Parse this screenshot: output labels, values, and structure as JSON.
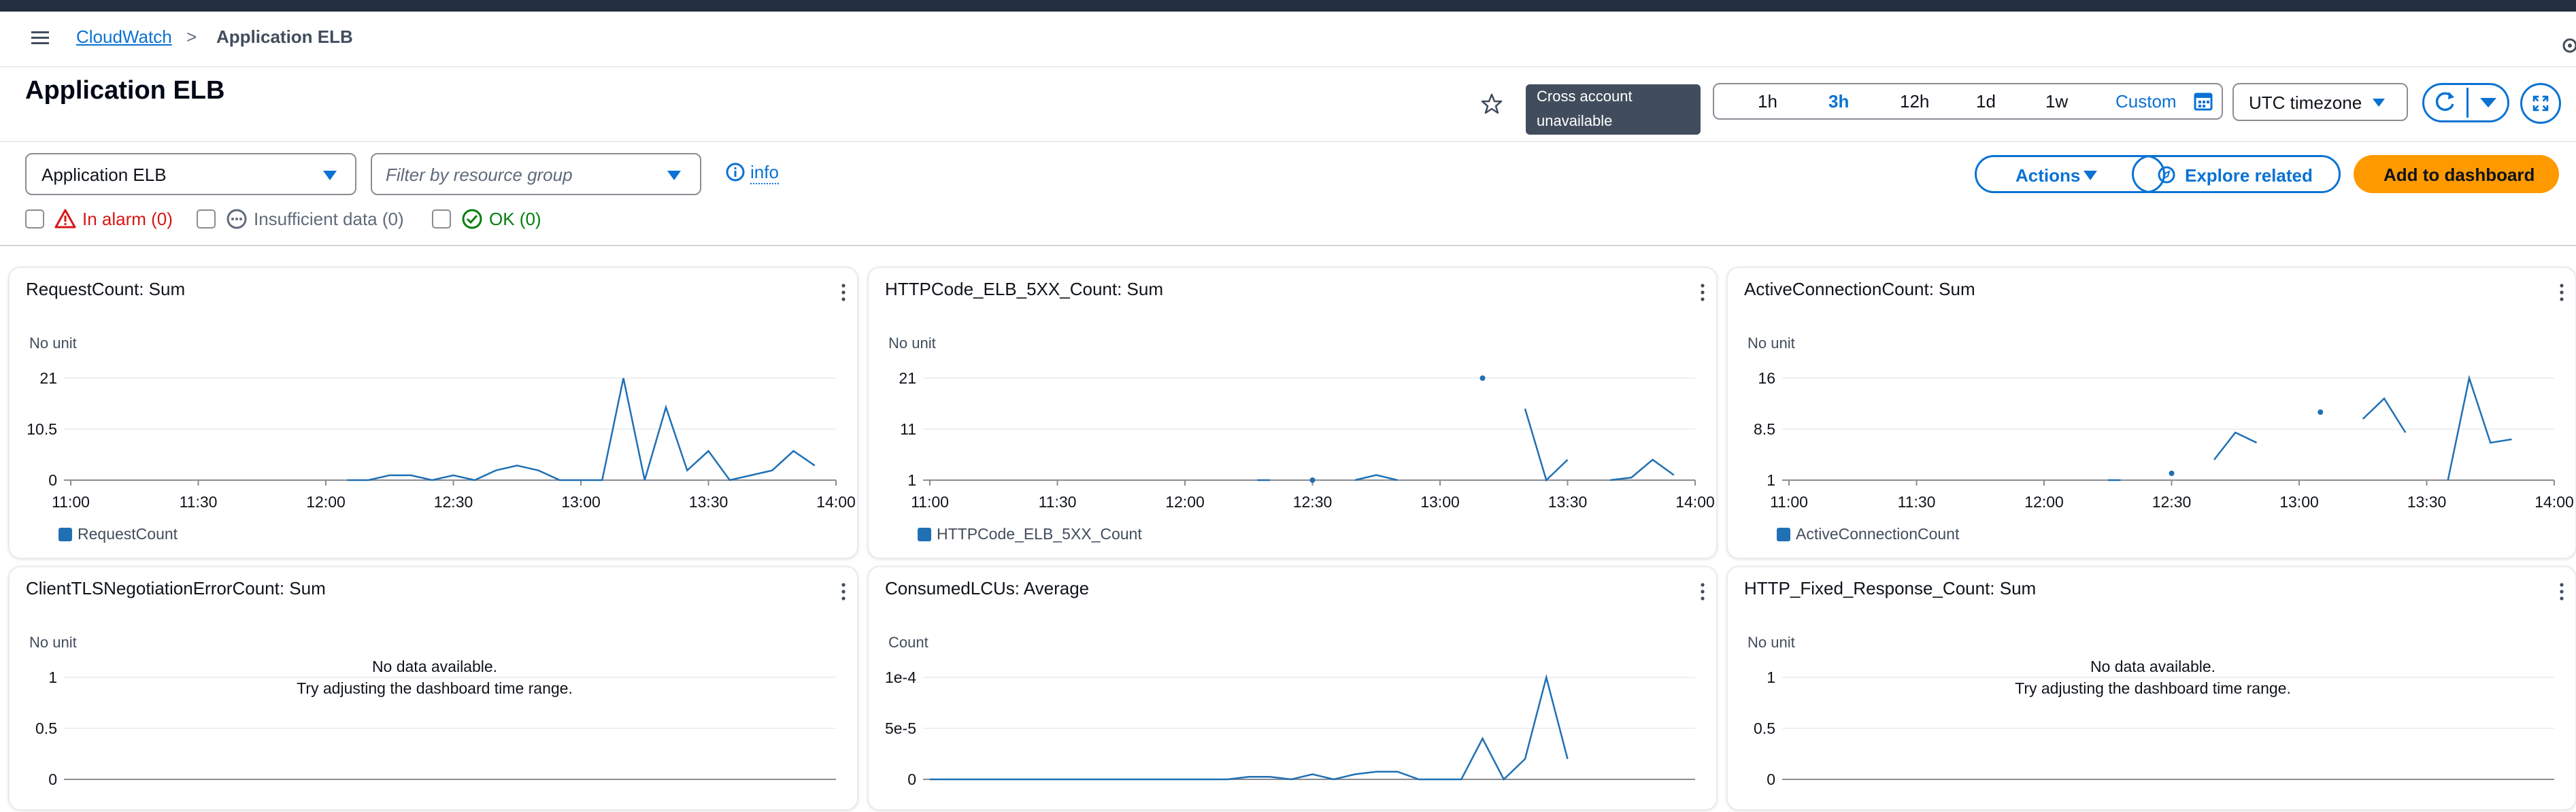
{
  "breadcrumb": {
    "root": "CloudWatch",
    "separator": ">",
    "current": "Application ELB"
  },
  "page_title": "Application ELB",
  "cross_account_tooltip": "Cross account unavailable",
  "time_range": {
    "options": [
      "1h",
      "3h",
      "12h",
      "1d",
      "1w"
    ],
    "selected": "3h",
    "custom_label": "Custom"
  },
  "timezone": {
    "label": "UTC timezone"
  },
  "filters": {
    "service_select_value": "Application ELB",
    "resource_group_placeholder": "Filter by resource group",
    "info_label": "info"
  },
  "alarm_states": {
    "in_alarm": "In alarm (0)",
    "insufficient": "Insufficient data (0)",
    "ok": "OK (0)"
  },
  "buttons": {
    "actions": "Actions",
    "explore_related": "Explore related",
    "add_to_dashboard": "Add to dashboard"
  },
  "colors": {
    "accent": "#0972d3",
    "series": "#2070b4",
    "primary_button": "#ff9900",
    "alarm": "#d91515",
    "ok": "#037f0c",
    "header_bar": "#232f3e"
  },
  "icons": [
    "menu-icon",
    "chevron-right-icon",
    "settings-icon",
    "star-icon",
    "calendar-icon",
    "caret-down-icon",
    "refresh-icon",
    "fullscreen-icon",
    "info-icon",
    "warning-icon",
    "dots-circle-icon",
    "check-circle-icon",
    "explore-icon",
    "kebab-icon"
  ],
  "widgets": [
    {
      "title": "RequestCount: Sum",
      "unit": "No unit",
      "legend": "RequestCount",
      "no_data": ""
    },
    {
      "title": "HTTPCode_ELB_5XX_Count: Sum",
      "unit": "No unit",
      "legend": "HTTPCode_ELB_5XX_Count",
      "no_data": ""
    },
    {
      "title": "ActiveConnectionCount: Sum",
      "unit": "No unit",
      "legend": "ActiveConnectionCount",
      "no_data": ""
    },
    {
      "title": "ClientTLSNegotiationErrorCount: Sum",
      "unit": "No unit",
      "legend": "",
      "no_data": "No data available.\nTry adjusting the dashboard time range."
    },
    {
      "title": "ConsumedLCUs: Average",
      "unit": "Count",
      "legend": "",
      "no_data": ""
    },
    {
      "title": "HTTP_Fixed_Response_Count: Sum",
      "unit": "No unit",
      "legend": "",
      "no_data": "No data available.\nTry adjusting the dashboard time range."
    }
  ],
  "chart_data": [
    {
      "type": "line",
      "title": "RequestCount: Sum",
      "ylabel": "No unit",
      "ylim": [
        0,
        21
      ],
      "y_ticks": [
        "0",
        "10.5",
        "21"
      ],
      "x_ticks": [
        "11:00",
        "11:30",
        "12:00",
        "12:30",
        "13:00",
        "13:30",
        "14:00"
      ],
      "xlim": [
        "11:00",
        "14:00"
      ],
      "grid": true,
      "legend_position": "bottom-left",
      "series": [
        {
          "name": "RequestCount",
          "points": [
            [
              "12:05",
              0
            ],
            [
              "12:10",
              0
            ],
            [
              "12:15",
              1
            ],
            [
              "12:20",
              1
            ],
            [
              "12:25",
              0
            ],
            [
              "12:30",
              1
            ],
            [
              "12:35",
              0
            ],
            [
              "12:40",
              2
            ],
            [
              "12:45",
              3
            ],
            [
              "12:50",
              2
            ],
            [
              "12:55",
              0
            ],
            [
              "13:00",
              0
            ],
            [
              "13:05",
              0
            ],
            [
              "13:10",
              21
            ],
            [
              "13:15",
              0
            ],
            [
              "13:20",
              15
            ],
            [
              "13:25",
              2
            ],
            [
              "13:30",
              6
            ],
            [
              "13:35",
              0
            ],
            [
              "13:40",
              1
            ],
            [
              "13:45",
              2
            ],
            [
              "13:50",
              6
            ],
            [
              "13:55",
              3
            ]
          ]
        }
      ]
    },
    {
      "type": "line",
      "title": "HTTPCode_ELB_5XX_Count: Sum",
      "ylabel": "No unit",
      "ylim": [
        1,
        21
      ],
      "y_ticks": [
        "1",
        "11",
        "21"
      ],
      "x_ticks": [
        "11:00",
        "11:30",
        "12:00",
        "12:30",
        "13:00",
        "13:30",
        "14:00"
      ],
      "xlim": [
        "11:00",
        "14:00"
      ],
      "grid": true,
      "legend_position": "bottom-left",
      "series": [
        {
          "name": "HTTPCode_ELB_5XX_Count",
          "segments": [
            [
              [
                "12:17",
                1
              ],
              [
                "12:20",
                1
              ]
            ],
            [
              [
                "12:30",
                1
              ]
            ],
            [
              [
                "12:40",
                1
              ],
              [
                "12:45",
                2
              ],
              [
                "12:50",
                1
              ]
            ],
            [
              [
                "13:10",
                21
              ]
            ],
            [
              [
                "13:20",
                15
              ],
              [
                "13:25",
                1
              ],
              [
                "13:30",
                5
              ]
            ],
            [
              [
                "13:40",
                1
              ],
              [
                "13:45",
                1.5
              ],
              [
                "13:50",
                5
              ],
              [
                "13:55",
                2
              ]
            ]
          ]
        }
      ]
    },
    {
      "type": "line",
      "title": "ActiveConnectionCount: Sum",
      "ylabel": "No unit",
      "ylim": [
        1,
        16
      ],
      "y_ticks": [
        "1",
        "8.5",
        "16"
      ],
      "x_ticks": [
        "11:00",
        "11:30",
        "12:00",
        "12:30",
        "13:00",
        "13:30",
        "14:00"
      ],
      "xlim": [
        "11:00",
        "14:00"
      ],
      "grid": true,
      "legend_position": "bottom-left",
      "series": [
        {
          "name": "ActiveConnectionCount",
          "segments": [
            [
              [
                "12:15",
                1
              ],
              [
                "12:18",
                1
              ]
            ],
            [
              [
                "12:30",
                2
              ]
            ],
            [
              [
                "12:40",
                4
              ],
              [
                "12:45",
                8
              ],
              [
                "12:50",
                6.5
              ]
            ],
            [
              [
                "13:05",
                11
              ]
            ],
            [
              [
                "13:15",
                10
              ],
              [
                "13:20",
                13
              ],
              [
                "13:25",
                8
              ]
            ],
            [
              [
                "13:35",
                1
              ],
              [
                "13:40",
                16
              ],
              [
                "13:45",
                6.5
              ],
              [
                "13:50",
                7
              ]
            ]
          ]
        }
      ]
    },
    {
      "type": "line",
      "title": "ClientTLSNegotiationErrorCount: Sum",
      "ylabel": "No unit",
      "ylim": [
        0,
        1
      ],
      "y_ticks": [
        "0",
        "0.5",
        "1"
      ],
      "grid": true,
      "series": []
    },
    {
      "type": "line",
      "title": "ConsumedLCUs: Average",
      "ylabel": "Count",
      "ylim": [
        0,
        0.0001
      ],
      "y_ticks": [
        "0",
        "5e-5",
        "1e-4"
      ],
      "grid": true,
      "series": [
        {
          "name": "ConsumedLCUs",
          "points": [
            [
              "11:00",
              0
            ],
            [
              "11:30",
              0
            ],
            [
              "12:00",
              0
            ],
            [
              "12:10",
              0
            ],
            [
              "12:15",
              2.5e-06
            ],
            [
              "12:20",
              2.5e-06
            ],
            [
              "12:25",
              0
            ],
            [
              "12:30",
              5e-06
            ],
            [
              "12:35",
              0
            ],
            [
              "12:40",
              5e-06
            ],
            [
              "12:45",
              7.5e-06
            ],
            [
              "12:50",
              7.5e-06
            ],
            [
              "12:55",
              0
            ],
            [
              "13:00",
              0
            ],
            [
              "13:05",
              0
            ],
            [
              "13:10",
              4e-05
            ],
            [
              "13:15",
              0
            ],
            [
              "13:20",
              2e-05
            ],
            [
              "13:25",
              0.0001
            ],
            [
              "13:30",
              2e-05
            ]
          ]
        }
      ]
    },
    {
      "type": "line",
      "title": "HTTP_Fixed_Response_Count: Sum",
      "ylabel": "No unit",
      "ylim": [
        0,
        1
      ],
      "y_ticks": [
        "0",
        "0.5",
        "1"
      ],
      "grid": true,
      "series": []
    }
  ]
}
